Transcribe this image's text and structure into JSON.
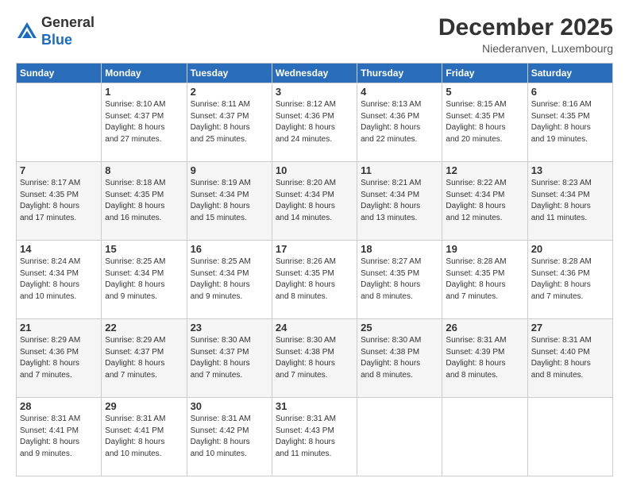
{
  "header": {
    "logo_general": "General",
    "logo_blue": "Blue",
    "month_title": "December 2025",
    "subtitle": "Niederanven, Luxembourg"
  },
  "weekdays": [
    "Sunday",
    "Monday",
    "Tuesday",
    "Wednesday",
    "Thursday",
    "Friday",
    "Saturday"
  ],
  "weeks": [
    {
      "shade": "white",
      "days": [
        {
          "num": "",
          "info": ""
        },
        {
          "num": "1",
          "info": "Sunrise: 8:10 AM\nSunset: 4:37 PM\nDaylight: 8 hours\nand 27 minutes."
        },
        {
          "num": "2",
          "info": "Sunrise: 8:11 AM\nSunset: 4:37 PM\nDaylight: 8 hours\nand 25 minutes."
        },
        {
          "num": "3",
          "info": "Sunrise: 8:12 AM\nSunset: 4:36 PM\nDaylight: 8 hours\nand 24 minutes."
        },
        {
          "num": "4",
          "info": "Sunrise: 8:13 AM\nSunset: 4:36 PM\nDaylight: 8 hours\nand 22 minutes."
        },
        {
          "num": "5",
          "info": "Sunrise: 8:15 AM\nSunset: 4:35 PM\nDaylight: 8 hours\nand 20 minutes."
        },
        {
          "num": "6",
          "info": "Sunrise: 8:16 AM\nSunset: 4:35 PM\nDaylight: 8 hours\nand 19 minutes."
        }
      ]
    },
    {
      "shade": "shade",
      "days": [
        {
          "num": "7",
          "info": "Sunrise: 8:17 AM\nSunset: 4:35 PM\nDaylight: 8 hours\nand 17 minutes."
        },
        {
          "num": "8",
          "info": "Sunrise: 8:18 AM\nSunset: 4:35 PM\nDaylight: 8 hours\nand 16 minutes."
        },
        {
          "num": "9",
          "info": "Sunrise: 8:19 AM\nSunset: 4:34 PM\nDaylight: 8 hours\nand 15 minutes."
        },
        {
          "num": "10",
          "info": "Sunrise: 8:20 AM\nSunset: 4:34 PM\nDaylight: 8 hours\nand 14 minutes."
        },
        {
          "num": "11",
          "info": "Sunrise: 8:21 AM\nSunset: 4:34 PM\nDaylight: 8 hours\nand 13 minutes."
        },
        {
          "num": "12",
          "info": "Sunrise: 8:22 AM\nSunset: 4:34 PM\nDaylight: 8 hours\nand 12 minutes."
        },
        {
          "num": "13",
          "info": "Sunrise: 8:23 AM\nSunset: 4:34 PM\nDaylight: 8 hours\nand 11 minutes."
        }
      ]
    },
    {
      "shade": "white",
      "days": [
        {
          "num": "14",
          "info": "Sunrise: 8:24 AM\nSunset: 4:34 PM\nDaylight: 8 hours\nand 10 minutes."
        },
        {
          "num": "15",
          "info": "Sunrise: 8:25 AM\nSunset: 4:34 PM\nDaylight: 8 hours\nand 9 minutes."
        },
        {
          "num": "16",
          "info": "Sunrise: 8:25 AM\nSunset: 4:34 PM\nDaylight: 8 hours\nand 9 minutes."
        },
        {
          "num": "17",
          "info": "Sunrise: 8:26 AM\nSunset: 4:35 PM\nDaylight: 8 hours\nand 8 minutes."
        },
        {
          "num": "18",
          "info": "Sunrise: 8:27 AM\nSunset: 4:35 PM\nDaylight: 8 hours\nand 8 minutes."
        },
        {
          "num": "19",
          "info": "Sunrise: 8:28 AM\nSunset: 4:35 PM\nDaylight: 8 hours\nand 7 minutes."
        },
        {
          "num": "20",
          "info": "Sunrise: 8:28 AM\nSunset: 4:36 PM\nDaylight: 8 hours\nand 7 minutes."
        }
      ]
    },
    {
      "shade": "shade",
      "days": [
        {
          "num": "21",
          "info": "Sunrise: 8:29 AM\nSunset: 4:36 PM\nDaylight: 8 hours\nand 7 minutes."
        },
        {
          "num": "22",
          "info": "Sunrise: 8:29 AM\nSunset: 4:37 PM\nDaylight: 8 hours\nand 7 minutes."
        },
        {
          "num": "23",
          "info": "Sunrise: 8:30 AM\nSunset: 4:37 PM\nDaylight: 8 hours\nand 7 minutes."
        },
        {
          "num": "24",
          "info": "Sunrise: 8:30 AM\nSunset: 4:38 PM\nDaylight: 8 hours\nand 7 minutes."
        },
        {
          "num": "25",
          "info": "Sunrise: 8:30 AM\nSunset: 4:38 PM\nDaylight: 8 hours\nand 8 minutes."
        },
        {
          "num": "26",
          "info": "Sunrise: 8:31 AM\nSunset: 4:39 PM\nDaylight: 8 hours\nand 8 minutes."
        },
        {
          "num": "27",
          "info": "Sunrise: 8:31 AM\nSunset: 4:40 PM\nDaylight: 8 hours\nand 8 minutes."
        }
      ]
    },
    {
      "shade": "white",
      "days": [
        {
          "num": "28",
          "info": "Sunrise: 8:31 AM\nSunset: 4:41 PM\nDaylight: 8 hours\nand 9 minutes."
        },
        {
          "num": "29",
          "info": "Sunrise: 8:31 AM\nSunset: 4:41 PM\nDaylight: 8 hours\nand 10 minutes."
        },
        {
          "num": "30",
          "info": "Sunrise: 8:31 AM\nSunset: 4:42 PM\nDaylight: 8 hours\nand 10 minutes."
        },
        {
          "num": "31",
          "info": "Sunrise: 8:31 AM\nSunset: 4:43 PM\nDaylight: 8 hours\nand 11 minutes."
        },
        {
          "num": "",
          "info": ""
        },
        {
          "num": "",
          "info": ""
        },
        {
          "num": "",
          "info": ""
        }
      ]
    }
  ]
}
